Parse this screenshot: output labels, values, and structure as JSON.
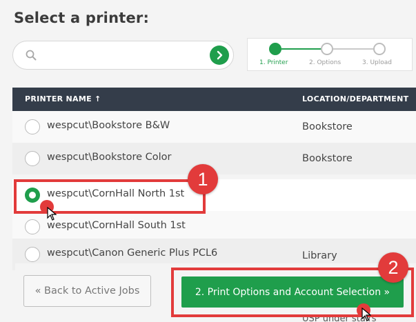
{
  "page": {
    "title": "Select a printer:"
  },
  "search": {
    "placeholder": "",
    "value": ""
  },
  "stepper": {
    "steps": [
      {
        "label": "1. Printer",
        "active": true
      },
      {
        "label": "2. Options",
        "active": false
      },
      {
        "label": "3. Upload",
        "active": false
      }
    ]
  },
  "table": {
    "columns": {
      "name": "PRINTER NAME ↑",
      "location": "LOCATION/DEPARTMENT"
    },
    "rows": [
      {
        "name": "wespcut\\Bookstore B&W",
        "location": "Bookstore",
        "selected": false
      },
      {
        "name": "wespcut\\Bookstore Color",
        "location": "Bookstore",
        "selected": false
      },
      {
        "name": "wespcut\\CornHall North 1st",
        "location": "",
        "selected": true
      },
      {
        "name": "wespcut\\CornHall South 1st",
        "location": "",
        "selected": false
      },
      {
        "name": "wespcut\\Canon Generic Plus PCL6",
        "location": "Library",
        "selected": false
      }
    ],
    "partial_location": "USP under stairs"
  },
  "footer": {
    "back_label": "« Back to Active Jobs",
    "next_label": "2. Print Options and Account Selection »"
  },
  "annotations": {
    "callout_1": "1",
    "callout_2": "2"
  },
  "colors": {
    "accent": "#1f9e4c",
    "header": "#343d4a",
    "annotation": "#e23b3b"
  }
}
